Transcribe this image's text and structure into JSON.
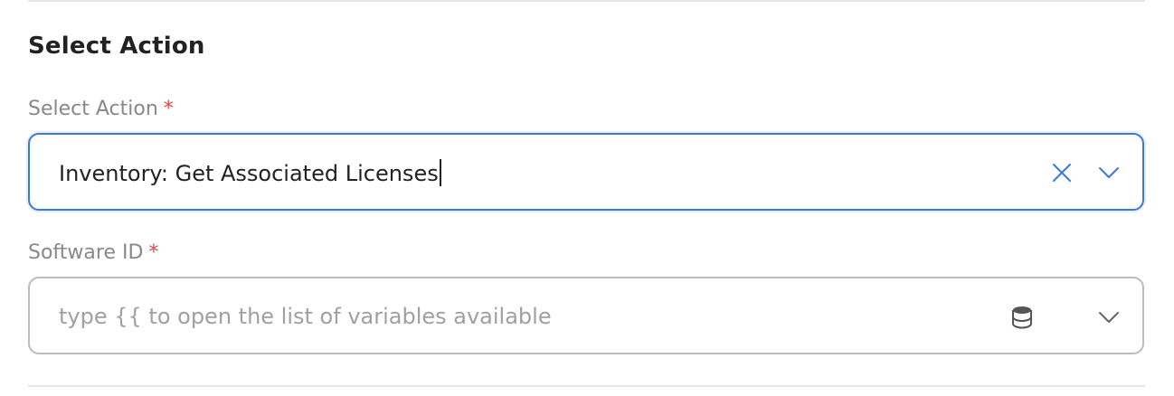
{
  "section": {
    "title": "Select Action"
  },
  "fields": {
    "action": {
      "label": "Select Action",
      "required_mark": "*",
      "value": "Inventory: Get Associated Licenses"
    },
    "software_id": {
      "label": "Software ID",
      "required_mark": "*",
      "placeholder": "type {{ to open the list of variables available"
    }
  },
  "colors": {
    "accent": "#3a78e0",
    "required": "#e04444",
    "label": "#888888",
    "placeholder": "#a0a0a0"
  },
  "icons": {
    "clear": "close-icon",
    "dropdown": "chevron-down-icon",
    "variables": "database-icon"
  }
}
